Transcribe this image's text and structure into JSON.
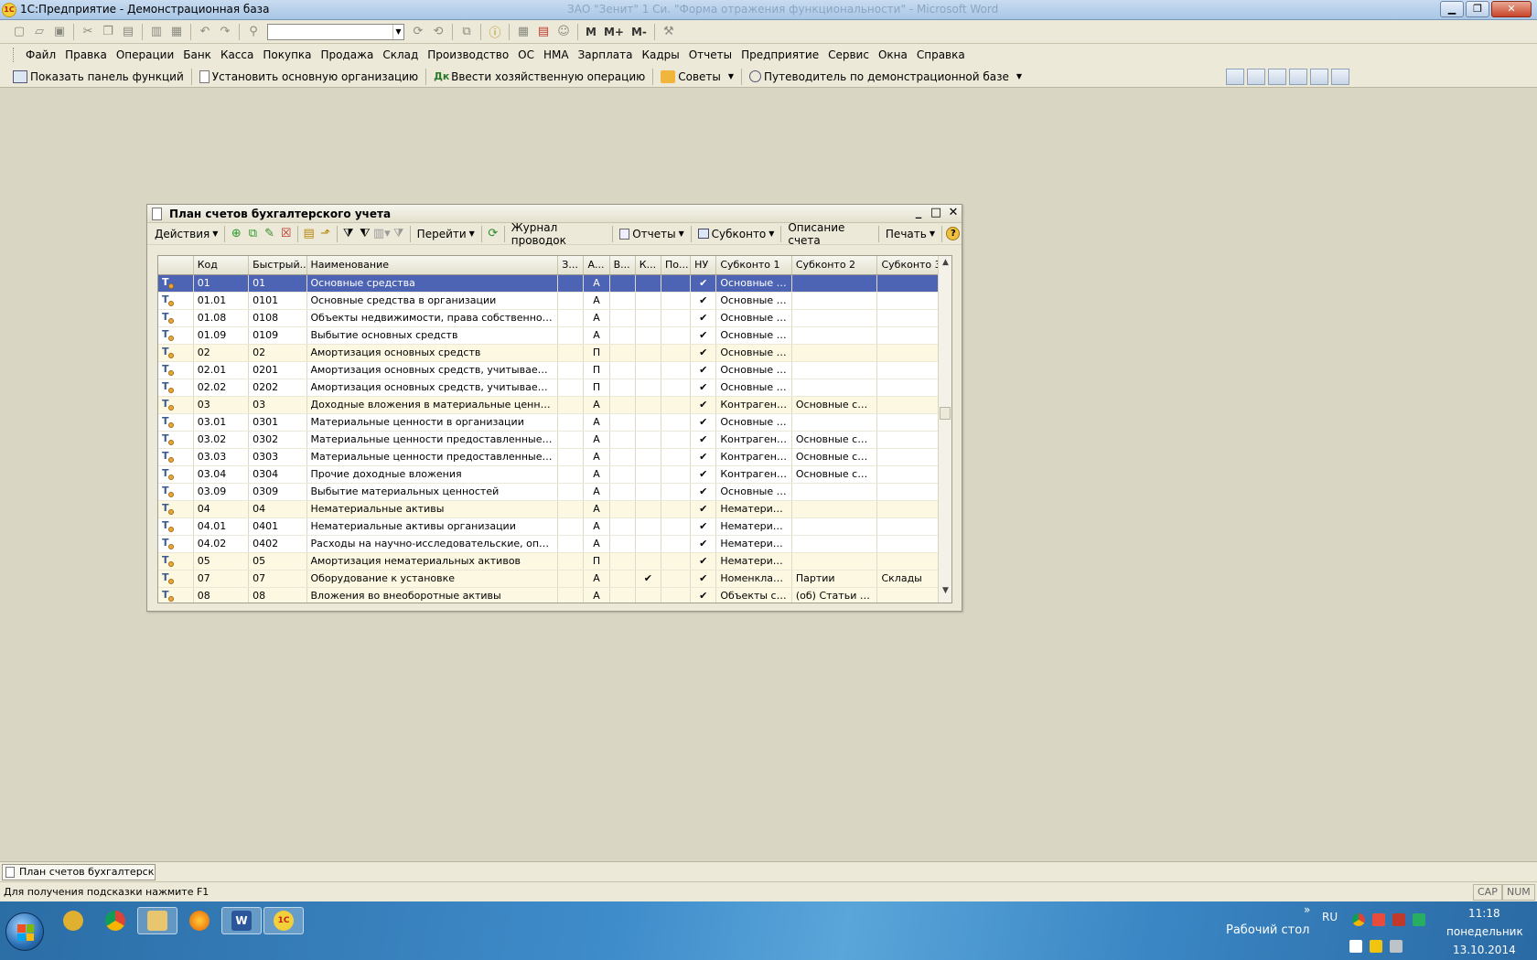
{
  "app": {
    "title": "1С:Предприятие - Демонстрационная база",
    "logo_text": "1С",
    "background_window_title": "ЗАО \"Зенит\" 1 Си. \"Форма отражения функциональности\" - Microsoft Word"
  },
  "window_controls": {
    "minimize": "▁",
    "restore": "❐",
    "close": "✕"
  },
  "std_toolbar": {
    "search_value": "",
    "memory_buttons": [
      "M",
      "M+",
      "M-"
    ]
  },
  "menu": [
    "Файл",
    "Правка",
    "Операции",
    "Банк",
    "Касса",
    "Покупка",
    "Продажа",
    "Склад",
    "Производство",
    "ОС",
    "НМА",
    "Зарплата",
    "Кадры",
    "Отчеты",
    "Предприятие",
    "Сервис",
    "Окна",
    "Справка"
  ],
  "function_toolbar": {
    "show_panel": "Показать панель функций",
    "set_org": "Установить основную организацию",
    "enter_operation": "Ввести хозяйственную операцию",
    "tips": "Советы",
    "guide": "Путеводитель по демонстрационной базе"
  },
  "form": {
    "title": "План счетов бухгалтерского учета",
    "controls": {
      "minimize": "_",
      "maximize": "□",
      "close": "✕"
    },
    "toolbar": {
      "actions": "Действия",
      "goto": "Перейти",
      "journal": "Журнал проводок",
      "reports": "Отчеты",
      "subconto": "Субконто",
      "description": "Описание счета",
      "print": "Печать",
      "help": "?"
    },
    "columns": [
      "",
      "Код",
      "Быстрый...",
      "Наименование",
      "З...",
      "А...",
      "В...",
      "К...",
      "По...",
      "НУ",
      "Субконто 1",
      "Субконто 2",
      "Субконто 3"
    ],
    "rows": [
      {
        "code": "01",
        "quick": "01",
        "name": "Основные средства",
        "z": "",
        "a": "А",
        "v": "",
        "k": "",
        "po": "",
        "nu": "✔",
        "s1": "Основные с...",
        "s2": "",
        "s3": "",
        "group": true,
        "selected": true
      },
      {
        "code": "01.01",
        "quick": "0101",
        "name": "Основные средства в организации",
        "z": "",
        "a": "А",
        "v": "",
        "k": "",
        "po": "",
        "nu": "✔",
        "s1": "Основные с...",
        "s2": "",
        "s3": "",
        "group": false,
        "selected": false
      },
      {
        "code": "01.08",
        "quick": "0108",
        "name": "Объекты недвижимости, права собственности на...",
        "z": "",
        "a": "А",
        "v": "",
        "k": "",
        "po": "",
        "nu": "✔",
        "s1": "Основные с...",
        "s2": "",
        "s3": "",
        "group": false,
        "selected": false
      },
      {
        "code": "01.09",
        "quick": "0109",
        "name": "Выбытие основных средств",
        "z": "",
        "a": "А",
        "v": "",
        "k": "",
        "po": "",
        "nu": "✔",
        "s1": "Основные с...",
        "s2": "",
        "s3": "",
        "group": false,
        "selected": false
      },
      {
        "code": "02",
        "quick": "02",
        "name": "Амортизация основных средств",
        "z": "",
        "a": "П",
        "v": "",
        "k": "",
        "po": "",
        "nu": "✔",
        "s1": "Основные с...",
        "s2": "",
        "s3": "",
        "group": true,
        "selected": false
      },
      {
        "code": "02.01",
        "quick": "0201",
        "name": "Амортизация основных средств, учитываемых на ...",
        "z": "",
        "a": "П",
        "v": "",
        "k": "",
        "po": "",
        "nu": "✔",
        "s1": "Основные с...",
        "s2": "",
        "s3": "",
        "group": false,
        "selected": false
      },
      {
        "code": "02.02",
        "quick": "0202",
        "name": "Амортизация основных средств, учитываемых на ...",
        "z": "",
        "a": "П",
        "v": "",
        "k": "",
        "po": "",
        "nu": "✔",
        "s1": "Основные с...",
        "s2": "",
        "s3": "",
        "group": false,
        "selected": false
      },
      {
        "code": "03",
        "quick": "03",
        "name": "Доходные вложения в материальные ценности",
        "z": "",
        "a": "А",
        "v": "",
        "k": "",
        "po": "",
        "nu": "✔",
        "s1": "Контрагенты",
        "s2": "Основные сре...",
        "s3": "",
        "group": true,
        "selected": false
      },
      {
        "code": "03.01",
        "quick": "0301",
        "name": "Материальные ценности в организации",
        "z": "",
        "a": "А",
        "v": "",
        "k": "",
        "po": "",
        "nu": "✔",
        "s1": "Основные с...",
        "s2": "",
        "s3": "",
        "group": false,
        "selected": false
      },
      {
        "code": "03.02",
        "quick": "0302",
        "name": "Материальные ценности предоставленные во вре...",
        "z": "",
        "a": "А",
        "v": "",
        "k": "",
        "po": "",
        "nu": "✔",
        "s1": "Контрагенты",
        "s2": "Основные сре...",
        "s3": "",
        "group": false,
        "selected": false
      },
      {
        "code": "03.03",
        "quick": "0303",
        "name": "Материальные ценности предоставленные во вре...",
        "z": "",
        "a": "А",
        "v": "",
        "k": "",
        "po": "",
        "nu": "✔",
        "s1": "Контрагенты",
        "s2": "Основные сре...",
        "s3": "",
        "group": false,
        "selected": false
      },
      {
        "code": "03.04",
        "quick": "0304",
        "name": "Прочие доходные вложения",
        "z": "",
        "a": "А",
        "v": "",
        "k": "",
        "po": "",
        "nu": "✔",
        "s1": "Контрагенты",
        "s2": "Основные сре...",
        "s3": "",
        "group": false,
        "selected": false
      },
      {
        "code": "03.09",
        "quick": "0309",
        "name": "Выбытие материальных ценностей",
        "z": "",
        "a": "А",
        "v": "",
        "k": "",
        "po": "",
        "nu": "✔",
        "s1": "Основные с...",
        "s2": "",
        "s3": "",
        "group": false,
        "selected": false
      },
      {
        "code": "04",
        "quick": "04",
        "name": "Нематериальные активы",
        "z": "",
        "a": "А",
        "v": "",
        "k": "",
        "po": "",
        "nu": "✔",
        "s1": "Нематериал...",
        "s2": "",
        "s3": "",
        "group": true,
        "selected": false
      },
      {
        "code": "04.01",
        "quick": "0401",
        "name": "Нематериальные активы организации",
        "z": "",
        "a": "А",
        "v": "",
        "k": "",
        "po": "",
        "nu": "✔",
        "s1": "Нематериал...",
        "s2": "",
        "s3": "",
        "group": false,
        "selected": false
      },
      {
        "code": "04.02",
        "quick": "0402",
        "name": "Расходы на научно-исследовательские, опытно-к...",
        "z": "",
        "a": "А",
        "v": "",
        "k": "",
        "po": "",
        "nu": "✔",
        "s1": "Нематериал...",
        "s2": "",
        "s3": "",
        "group": false,
        "selected": false
      },
      {
        "code": "05",
        "quick": "05",
        "name": "Амортизация нематериальных активов",
        "z": "",
        "a": "П",
        "v": "",
        "k": "",
        "po": "",
        "nu": "✔",
        "s1": "Нематериал...",
        "s2": "",
        "s3": "",
        "group": true,
        "selected": false
      },
      {
        "code": "07",
        "quick": "07",
        "name": "Оборудование к установке",
        "z": "",
        "a": "А",
        "v": "",
        "k": "✔",
        "po": "",
        "nu": "✔",
        "s1": "Номенклату...",
        "s2": "Партии",
        "s3": "Склады",
        "group": true,
        "selected": false
      },
      {
        "code": "08",
        "quick": "08",
        "name": "Вложения во внеоборотные активы",
        "z": "",
        "a": "А",
        "v": "",
        "k": "",
        "po": "",
        "nu": "✔",
        "s1": "Объекты ст...",
        "s2": "(об) Статьи за...",
        "s3": "",
        "group": true,
        "selected": false
      }
    ]
  },
  "window_bar": {
    "tab": "План счетов бухгалтерског..."
  },
  "status": {
    "hint": "Для получения подсказки нажмите F1",
    "cap": "CAP",
    "num": "NUM"
  },
  "taskbar": {
    "desktop": "Рабочий стол",
    "lang": "RU",
    "time": "11:18",
    "day": "понедельник",
    "date": "13.10.2014",
    "arrows": "»"
  }
}
